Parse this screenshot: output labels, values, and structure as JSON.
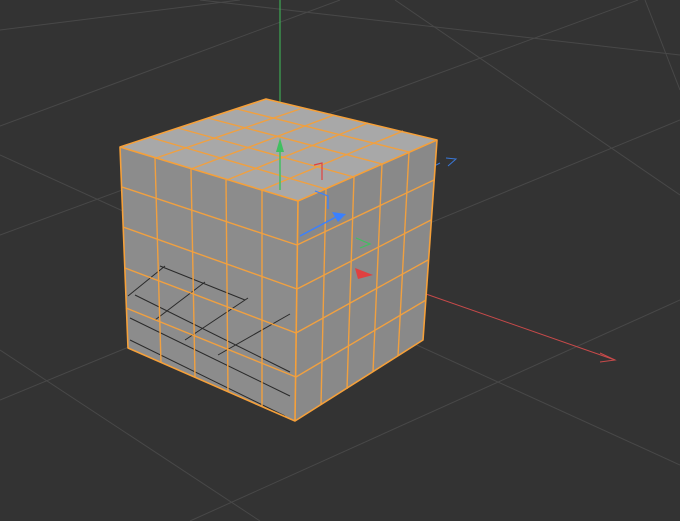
{
  "viewport": {
    "background": "#333333",
    "grid_color": "#484848",
    "selection_color": "#f5a03a",
    "object": "cube",
    "subdivisions": 5,
    "selected": true
  },
  "axes": {
    "x_color": "#c84a4a",
    "y_color": "#3fbf5a",
    "z_color": "#3a78d8"
  },
  "gizmo": {
    "x_color": "#e04040",
    "y_color": "#40c060",
    "z_color": "#3a80ff",
    "icons": [
      "move-x-arrow-icon",
      "move-y-arrow-icon",
      "move-z-arrow-icon"
    ]
  }
}
